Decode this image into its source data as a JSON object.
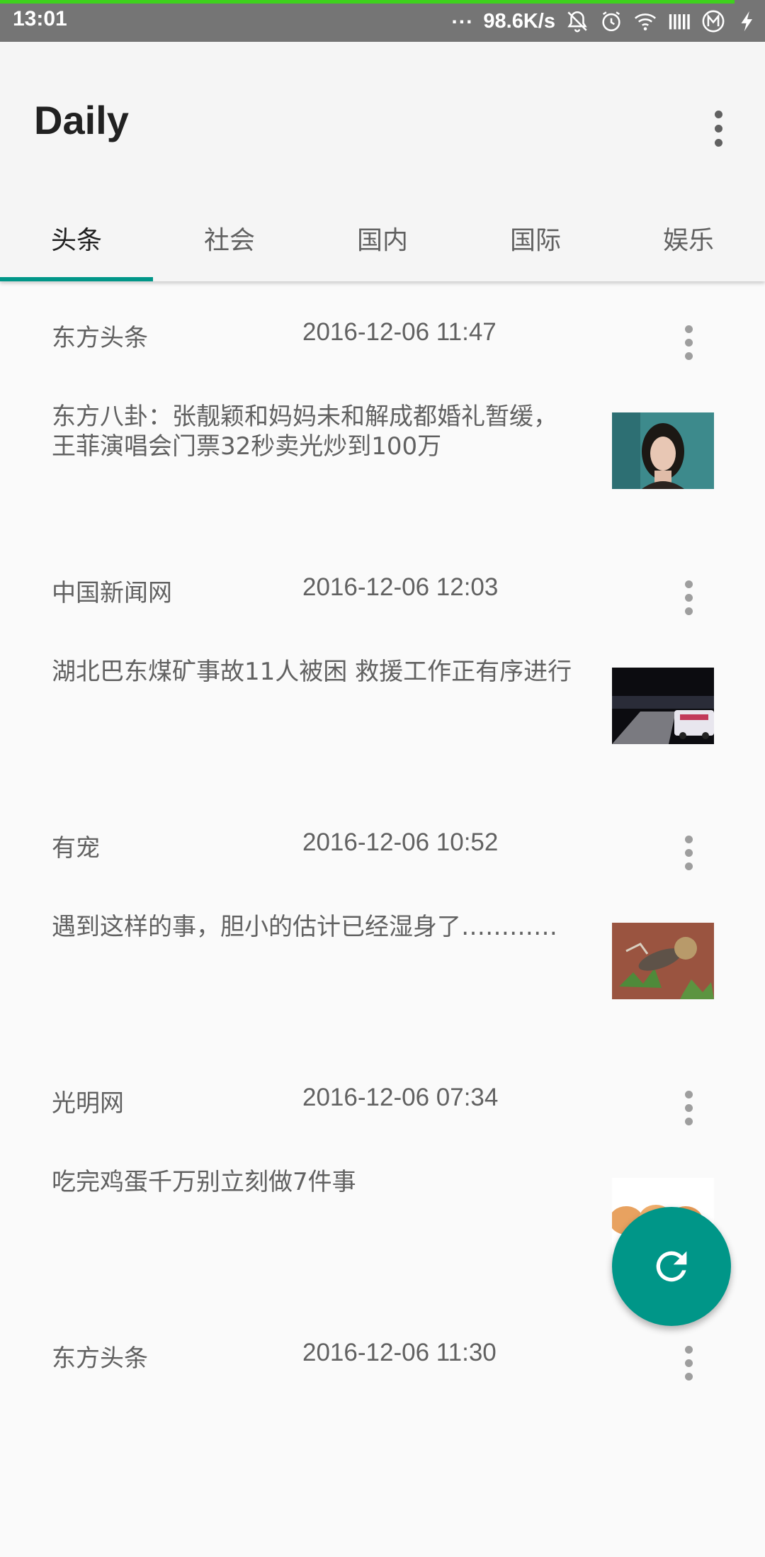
{
  "status_bar": {
    "time": "13:01",
    "dots": "...",
    "speed": "98.6K/s",
    "download_progress": 0.96,
    "icons": [
      "bell-off-icon",
      "alarm-icon",
      "wifi-icon",
      "signal-icon",
      "m-icon",
      "charging-icon"
    ]
  },
  "app_bar": {
    "title": "Daily",
    "overflow_icon": "more-vert-icon"
  },
  "tabs": [
    {
      "label": "头条",
      "active": true
    },
    {
      "label": "社会",
      "active": false
    },
    {
      "label": "国内",
      "active": false
    },
    {
      "label": "国际",
      "active": false
    },
    {
      "label": "娱乐",
      "active": false
    }
  ],
  "news": [
    {
      "source": "东方头条",
      "time": "2016-12-06 11:47",
      "headline": "东方八卦：张靓颖和妈妈未和解成都婚礼暂缓，王菲演唱会门票32秒卖光炒到100万",
      "thumb": "portrait-photo"
    },
    {
      "source": "中国新闻网",
      "time": "2016-12-06 12:03",
      "headline": "湖北巴东煤矿事故11人被困 救援工作正有序进行",
      "thumb": "night-rescue-photo"
    },
    {
      "source": "有宠",
      "time": "2016-12-06 10:52",
      "headline": "遇到这样的事，胆小的估计已经湿身了…………",
      "thumb": "animal-ground-photo"
    },
    {
      "source": "光明网",
      "time": "2016-12-06 07:34",
      "headline": "吃完鸡蛋千万别立刻做7件事",
      "thumb": "eggs-photo"
    },
    {
      "source": "东方头条",
      "time": "2016-12-06 11:30",
      "headline": "",
      "thumb": ""
    }
  ],
  "fab": {
    "icon": "refresh-icon"
  },
  "colors": {
    "accent": "#009688",
    "status_bar": "#757575",
    "progress": "#3fd11d"
  }
}
